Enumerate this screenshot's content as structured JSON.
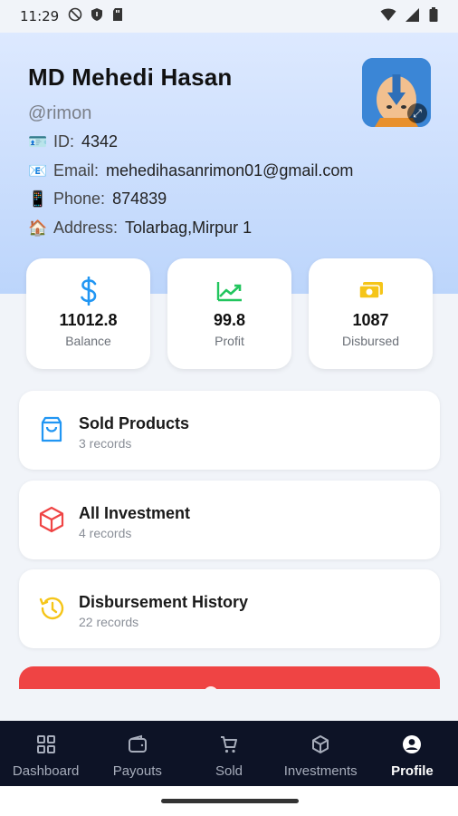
{
  "status_bar": {
    "time": "11:29"
  },
  "profile": {
    "name": "MD Mehedi Hasan",
    "handle": "@rimon",
    "id_label": "ID:",
    "id_value": "4342",
    "email_label": "Email:",
    "email_value": "mehedihasanrimon01@gmail.com",
    "phone_label": "Phone:",
    "phone_value": "874839",
    "address_label": "Address:",
    "address_value": "Tolarbag,Mirpur 1",
    "avatar_icon": "aang-avatar"
  },
  "stats": [
    {
      "value": "11012.8",
      "label": "Balance",
      "icon": "dollar-icon",
      "color": "#2196f3"
    },
    {
      "value": "99.8",
      "label": "Profit",
      "icon": "trending-up-icon",
      "color": "#22c55e"
    },
    {
      "value": "1087",
      "label": "Disbursed",
      "icon": "cash-icon",
      "color": "#f5c518"
    }
  ],
  "records": [
    {
      "title": "Sold Products",
      "subtitle": "3 records",
      "icon": "shopping-bag-icon",
      "color": "#2196f3"
    },
    {
      "title": "All Investment",
      "subtitle": "4 records",
      "icon": "cube-icon",
      "color": "#ef4444"
    },
    {
      "title": "Disbursement History",
      "subtitle": "22 records",
      "icon": "history-icon",
      "color": "#f5c518"
    }
  ],
  "nav": {
    "items": [
      {
        "label": "Dashboard",
        "icon": "grid-icon"
      },
      {
        "label": "Payouts",
        "icon": "wallet-icon"
      },
      {
        "label": "Sold",
        "icon": "cart-icon"
      },
      {
        "label": "Investments",
        "icon": "box-icon"
      },
      {
        "label": "Profile",
        "icon": "user-circle-icon"
      }
    ],
    "active": "Profile"
  },
  "colors": {
    "accent_red": "#ef4444",
    "nav_bg": "#0d1326",
    "hero_top": "#dde9ff",
    "hero_bottom": "#bcd5fb"
  }
}
